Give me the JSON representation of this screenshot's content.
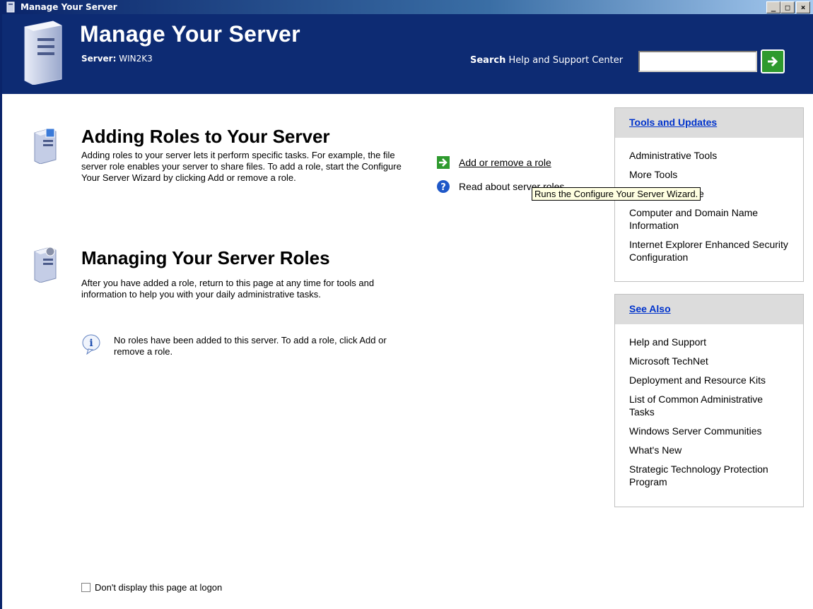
{
  "window": {
    "title": "Manage Your Server"
  },
  "header": {
    "title": "Manage Your Server",
    "server_label": "Server:",
    "server_name": "WIN2K3",
    "search_label_bold": "Search",
    "search_label_rest": " Help and Support Center",
    "search_value": ""
  },
  "sections": {
    "adding": {
      "title": "Adding Roles to Your Server",
      "body": "Adding roles to your server lets it perform specific tasks. For example, the file server role enables your server to share files. To add a role, start the Configure Your Server Wizard by clicking Add or remove a role."
    },
    "managing": {
      "title": "Managing Your Server Roles",
      "body": "After you have added a role, return to this page at any time for tools and information to help you with your daily administrative tasks.",
      "info": "No roles have been added to this server. To add a role, click Add or remove a role."
    }
  },
  "actions": {
    "add_remove": "Add or remove a role",
    "read_about": "Read about server roles"
  },
  "tooltip": "Runs the Configure Your Server Wizard.",
  "tools_panel": {
    "heading": "Tools and Updates",
    "items": [
      "Administrative Tools",
      "More Tools",
      "Windows Update",
      "Computer and Domain Name Information",
      "Internet Explorer Enhanced Security Configuration"
    ]
  },
  "see_also_panel": {
    "heading": "See Also",
    "items": [
      "Help and Support",
      "Microsoft TechNet",
      "Deployment and Resource Kits",
      "List of Common Administrative Tasks",
      "Windows Server Communities",
      "What's New",
      "Strategic Technology Protection Program"
    ]
  },
  "footer": {
    "checkbox_label": "Don't display this page at logon",
    "checked": false
  },
  "colors": {
    "header_bg": "#0d2b73",
    "panel_head": "#dcdcdc",
    "link": "#0033cc",
    "tooltip_bg": "#ffffe1"
  }
}
